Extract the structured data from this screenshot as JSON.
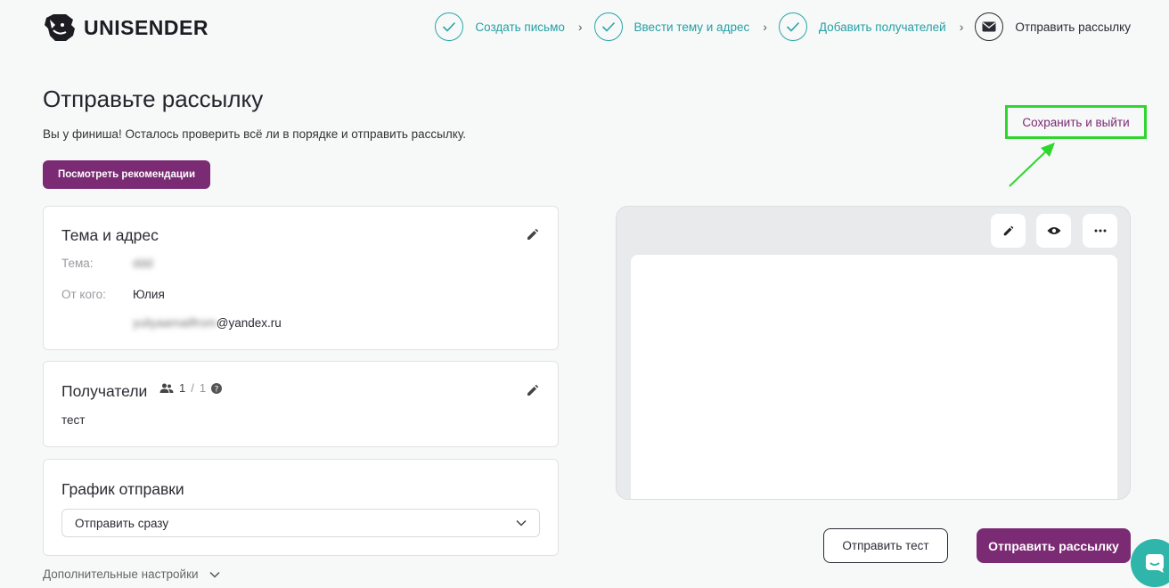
{
  "header": {
    "logo_text": "UNISENDER",
    "steps": [
      {
        "label": "Создать письмо",
        "state": "done",
        "icon": "check-icon"
      },
      {
        "label": "Ввести тему и адрес",
        "state": "done",
        "icon": "check-icon"
      },
      {
        "label": "Добавить получателей",
        "state": "done",
        "icon": "check-icon"
      },
      {
        "label": "Отправить рассылку",
        "state": "active",
        "icon": "envelope-icon"
      }
    ],
    "step_separator": "›"
  },
  "page": {
    "title": "Отправьте рассылку",
    "subtitle": "Вы у финиша! Осталось проверить всё ли в порядке и отправить рассылку.",
    "recommendations_button": "Посмотреть рекомендации",
    "save_exit_link": "Сохранить и выйти"
  },
  "subject_card": {
    "title": "Тема и адрес",
    "subject_label": "Тема:",
    "subject_value": "ddd",
    "from_label": "От кого:",
    "from_name": "Юлия",
    "from_email_user": "yuliyaamailfrom",
    "from_email_domain": "@yandex.ru"
  },
  "recipients_card": {
    "title": "Получатели",
    "count": "1",
    "total": "1",
    "list_name": "тест"
  },
  "schedule_card": {
    "title": "График отправки",
    "selected_option": "Отправить сразу"
  },
  "extra_settings": "Дополнительные настройки",
  "actions": {
    "send_test": "Отправить тест",
    "send_campaign": "Отправить рассылку"
  },
  "colors": {
    "brand_purple": "#7b2a74",
    "teal": "#26a0a4",
    "highlight_green": "#2ed62e"
  }
}
